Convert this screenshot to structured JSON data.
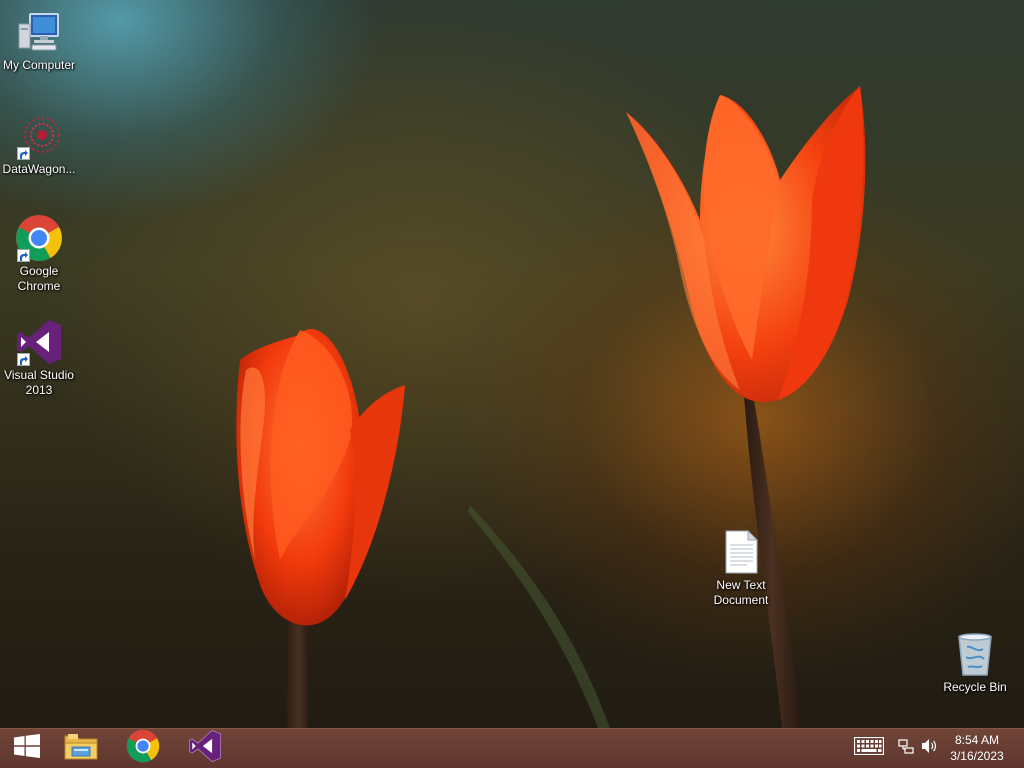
{
  "desktop": {
    "icons": [
      {
        "id": "my-computer",
        "label": "My Computer",
        "icon": "computer-icon",
        "shortcut": false
      },
      {
        "id": "datawagon",
        "label": "DataWagon...",
        "icon": "datawagon-icon",
        "shortcut": true
      },
      {
        "id": "chrome",
        "label": "Google Chrome",
        "icon": "chrome-icon",
        "shortcut": true
      },
      {
        "id": "visual-studio",
        "label": "Visual Studio 2013",
        "icon": "visual-studio-icon",
        "shortcut": true
      },
      {
        "id": "new-text-document",
        "label": "New Text Document",
        "icon": "text-document-icon",
        "shortcut": false
      },
      {
        "id": "recycle-bin",
        "label": "Recycle Bin",
        "icon": "recycle-bin-icon",
        "shortcut": false
      }
    ]
  },
  "taskbar": {
    "start_icon": "windows-start-icon",
    "pinned": [
      {
        "id": "file-explorer",
        "icon": "file-explorer-icon"
      },
      {
        "id": "chrome",
        "icon": "chrome-icon"
      },
      {
        "id": "visual-studio",
        "icon": "visual-studio-icon"
      }
    ],
    "tray": {
      "icons": [
        "keyboard-icon",
        "network-icon",
        "volume-icon"
      ],
      "time": "8:54 AM",
      "date": "3/16/2023"
    }
  },
  "colors": {
    "taskbar": "#6e4034",
    "vs_purple": "#68217a",
    "chrome_red": "#db4437",
    "chrome_yellow": "#f4c20d",
    "chrome_green": "#0f9d58",
    "chrome_blue": "#4285f4",
    "tulip": "#ff4a12"
  }
}
